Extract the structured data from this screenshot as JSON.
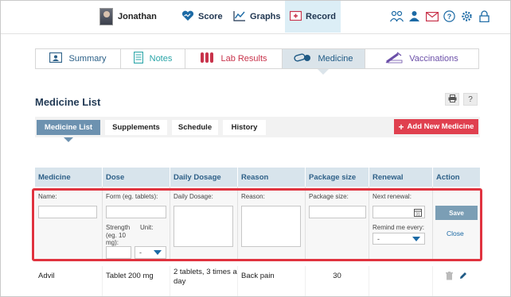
{
  "user": {
    "name": "Jonathan"
  },
  "nav": {
    "items": [
      {
        "label": "Score",
        "icon": "heart-graph-icon"
      },
      {
        "label": "Graphs",
        "icon": "line-chart-icon"
      },
      {
        "label": "Record",
        "icon": "record-folder-icon"
      }
    ],
    "header_icons": [
      "people-icon",
      "user-add-icon",
      "mail-icon",
      "help-icon",
      "gear-icon",
      "lock-icon"
    ]
  },
  "section_tabs": [
    {
      "label": "Summary",
      "icon": "summary-icon"
    },
    {
      "label": "Notes",
      "icon": "notes-icon"
    },
    {
      "label": "Lab Results",
      "icon": "test-tubes-icon"
    },
    {
      "label": "Medicine",
      "icon": "pill-icon"
    },
    {
      "label": "Vaccinations",
      "icon": "syringe-icon"
    }
  ],
  "page": {
    "title": "Medicine List",
    "print_icon": "print-icon",
    "help_label": "?"
  },
  "sub_tabs": [
    {
      "label": "Medicine List"
    },
    {
      "label": "Supplements"
    },
    {
      "label": "Schedule"
    },
    {
      "label": "History"
    }
  ],
  "add_button": {
    "plus": "+",
    "label": "Add New Medicine"
  },
  "table": {
    "columns": [
      "Medicine",
      "Dose",
      "Daily Dosage",
      "Reason",
      "Package size",
      "Renewal",
      "Action"
    ],
    "edit_row": {
      "name_label": "Name:",
      "form_label": "Form (eg. tablets):",
      "strength_label": "Strength (eg. 10 mg):",
      "unit_label": "Unit:",
      "unit_value": "-",
      "daily_dosage_label": "Daily Dosage:",
      "reason_label": "Reason:",
      "package_label": "Package size:",
      "next_renewal_label": "Next renewal:",
      "remind_label": "Remind me every:",
      "remind_value": "-",
      "save_label": "Save",
      "close_label": "Close"
    },
    "rows": [
      {
        "medicine": "Advil",
        "dose": "Tablet 200 mg",
        "daily_dosage": "2 tablets, 3 times a day",
        "reason": "Back pain",
        "package_size": "30",
        "renewal": ""
      }
    ]
  },
  "colors": {
    "accent": "#1c6aa5",
    "highlight": "#e0333f",
    "add_button": "#e0404f",
    "active_subtab": "#6d92b0"
  }
}
